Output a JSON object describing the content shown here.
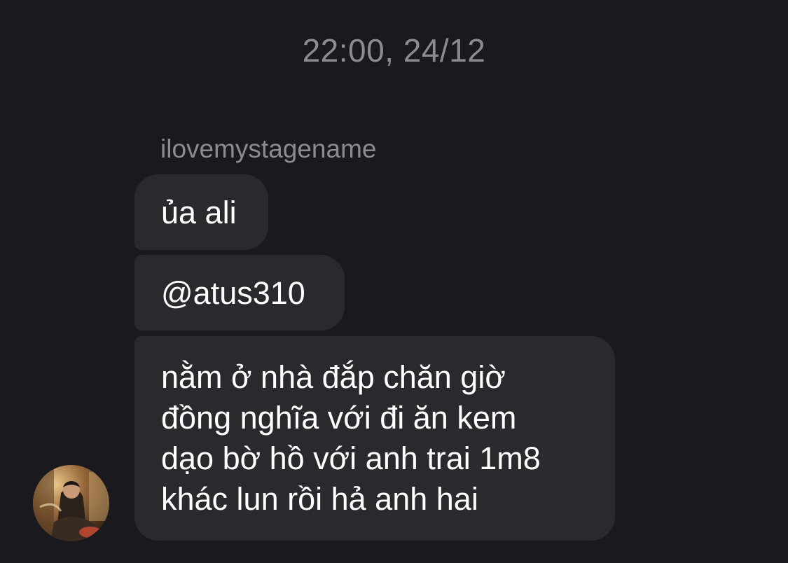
{
  "thread": {
    "timestamp": "22:00, 24/12",
    "sender_name": "ilovemystagename"
  },
  "messages": [
    {
      "text": "ủa ali"
    },
    {
      "text": "@atus310"
    },
    {
      "lines": [
        "nằm ở nhà đắp chăn giờ",
        "đồng nghĩa với đi ăn kem",
        "dạo bờ hồ với anh trai 1m8",
        "khác lun rồi hả anh hai"
      ]
    }
  ],
  "colors": {
    "background": "#1a191d",
    "bubble": "#2a292e",
    "meta_text": "#8c8b92",
    "message_text": "#ffffff"
  },
  "icons": {
    "avatar": "sender-avatar-photo"
  }
}
